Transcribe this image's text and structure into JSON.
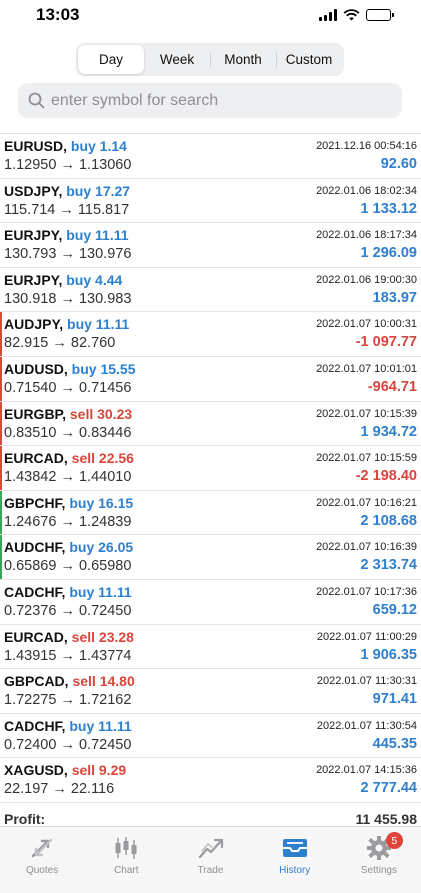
{
  "status_bar": {
    "time": "13:03"
  },
  "segments": [
    {
      "label": "Day",
      "active": true
    },
    {
      "label": "Week",
      "active": false
    },
    {
      "label": "Month",
      "active": false
    },
    {
      "label": "Custom",
      "active": false
    }
  ],
  "search": {
    "placeholder": "enter symbol for search"
  },
  "trades": [
    {
      "symbol": "EURUSD,",
      "side": "buy 1.14",
      "prices": "1.12950 → 1.13060",
      "time": "2021.12.16 00:54:16",
      "pl": "92.60"
    },
    {
      "symbol": "USDJPY,",
      "side": "buy 17.27",
      "prices": "115.714 → 115.817",
      "time": "2022.01.06 18:02:34",
      "pl": "1 133.12"
    },
    {
      "symbol": "EURJPY,",
      "side": "buy 11.11",
      "prices": "130.793 → 130.976",
      "time": "2022.01.06 18:17:34",
      "pl": "1 296.09"
    },
    {
      "symbol": "EURJPY,",
      "side": "buy 4.44",
      "prices": "130.918 → 130.983",
      "time": "2022.01.06 19:00:30",
      "pl": "183.97"
    },
    {
      "symbol": "AUDJPY,",
      "side": "buy 11.11",
      "prices": "82.915 → 82.760",
      "time": "2022.01.07 10:00:31",
      "pl": "-1 097.77"
    },
    {
      "symbol": "AUDUSD,",
      "side": "buy 15.55",
      "prices": "0.71540 → 0.71456",
      "time": "2022.01.07 10:01:01",
      "pl": "-964.71"
    },
    {
      "symbol": "EURGBP,",
      "side": "sell 30.23",
      "prices": "0.83510 → 0.83446",
      "time": "2022.01.07 10:15:39",
      "pl": "1 934.72"
    },
    {
      "symbol": "EURCAD,",
      "side": "sell 22.56",
      "prices": "1.43842 → 1.44010",
      "time": "2022.01.07 10:15:59",
      "pl": "-2 198.40"
    },
    {
      "symbol": "GBPCHF,",
      "side": "buy 16.15",
      "prices": "1.24676 → 1.24839",
      "time": "2022.01.07 10:16:21",
      "pl": "2 108.68"
    },
    {
      "symbol": "AUDCHF,",
      "side": "buy 26.05",
      "prices": "0.65869 → 0.65980",
      "time": "2022.01.07 10:16:39",
      "pl": "2 313.74"
    },
    {
      "symbol": "CADCHF,",
      "side": "buy 11.11",
      "prices": "0.72376 → 0.72450",
      "time": "2022.01.07 10:17:36",
      "pl": "659.12"
    },
    {
      "symbol": "EURCAD,",
      "side": "sell 23.28",
      "prices": "1.43915 → 1.43774",
      "time": "2022.01.07 11:00:29",
      "pl": "1 906.35"
    },
    {
      "symbol": "GBPCAD,",
      "side": "sell 14.80",
      "prices": "1.72275 → 1.72162",
      "time": "2022.01.07 11:30:31",
      "pl": "971.41"
    },
    {
      "symbol": "CADCHF,",
      "side": "buy 11.11",
      "prices": "0.72400 → 0.72450",
      "time": "2022.01.07 11:30:54",
      "pl": "445.35"
    },
    {
      "symbol": "XAGUSD,",
      "side": "sell 9.29",
      "prices": "22.197 → 22.116",
      "time": "2022.01.07 14:15:36",
      "pl": "2 777.44"
    }
  ],
  "summary": {
    "label": "Profit:",
    "value": "11 455.98"
  },
  "tabs": [
    {
      "label": "Quotes",
      "icon": "quotes-icon",
      "active": false
    },
    {
      "label": "Chart",
      "icon": "chart-icon",
      "active": false
    },
    {
      "label": "Trade",
      "icon": "trade-icon",
      "active": false
    },
    {
      "label": "History",
      "icon": "history-icon",
      "active": true
    },
    {
      "label": "Settings",
      "icon": "settings-icon",
      "active": false,
      "badge": "5"
    }
  ],
  "colors": {
    "buy": "#2d7fcf",
    "sell": "#d8463b",
    "profit": "#2d7fcf",
    "loss": "#d8463b",
    "accent": "#2d7fcf"
  }
}
